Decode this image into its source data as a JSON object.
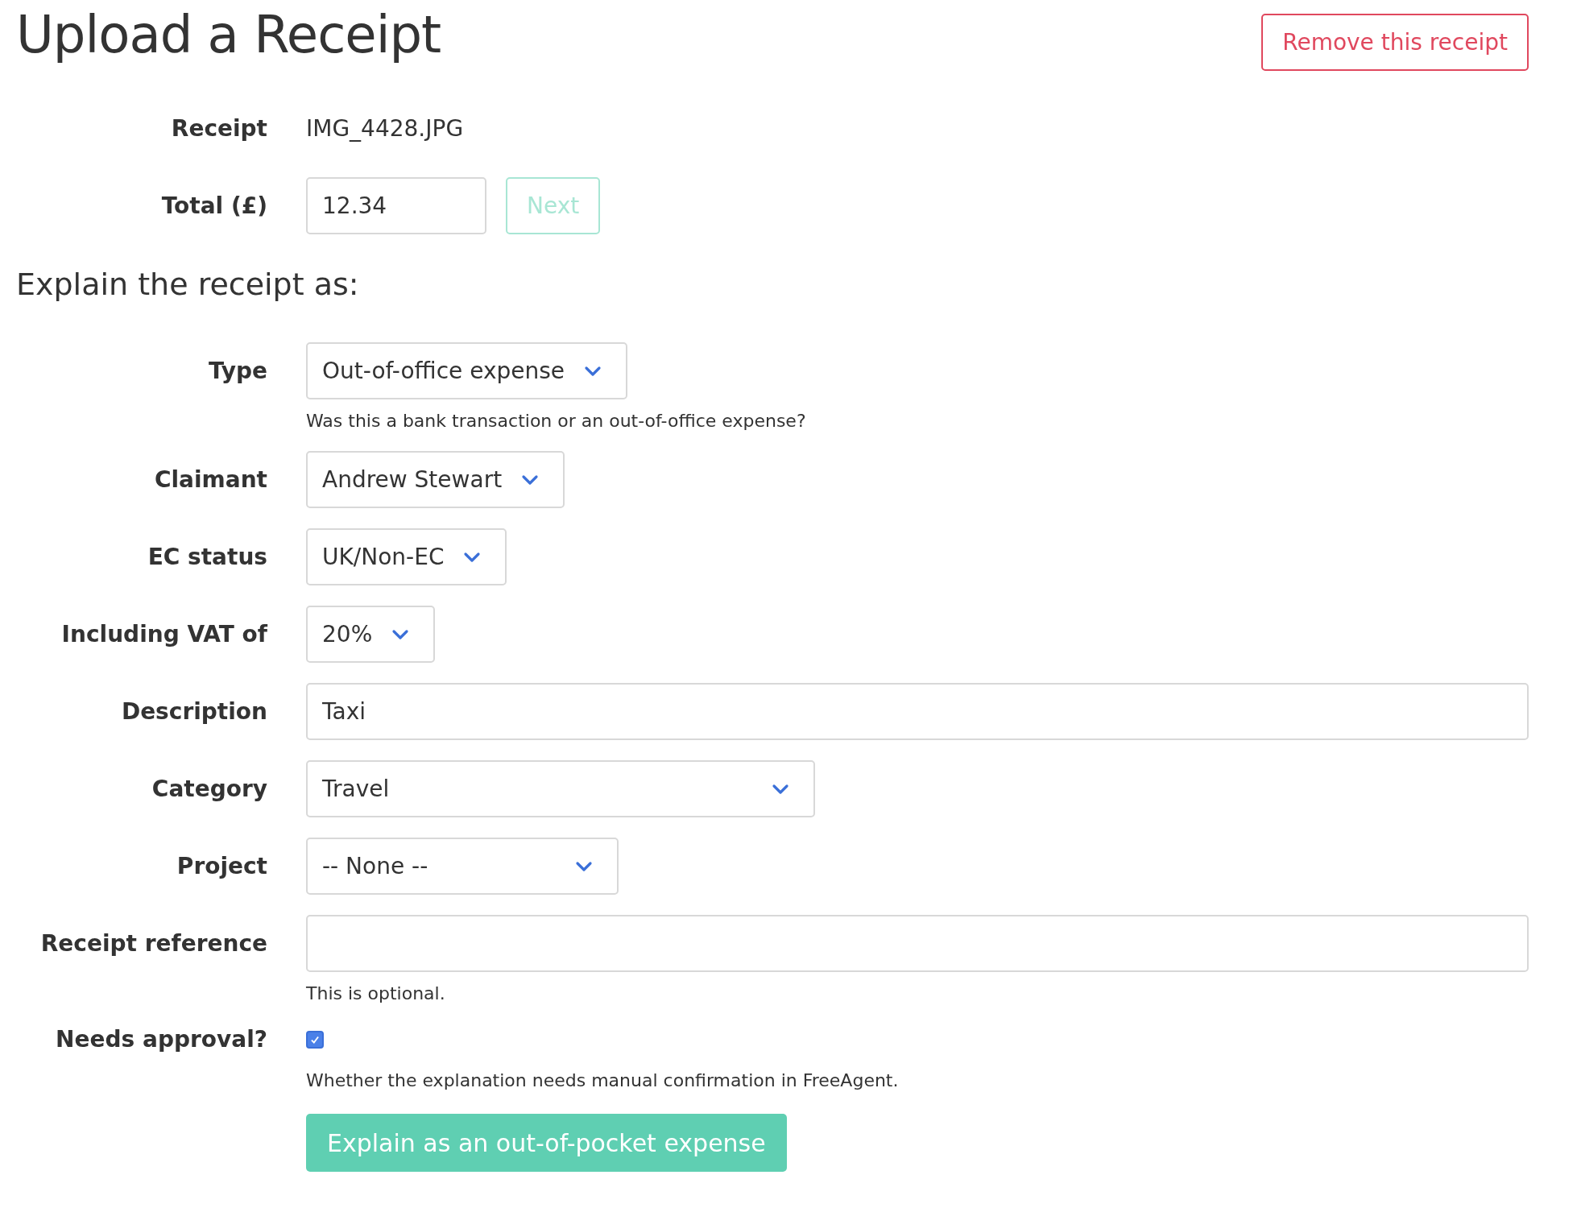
{
  "title": "Upload a Receipt",
  "remove_button": "Remove this receipt",
  "receipt_fields": [
    {
      "kind": "text",
      "label": "Receipt",
      "value": "IMG_4428.JPG"
    },
    {
      "kind": "input",
      "label": "Total (£)",
      "value": "12.34",
      "button": {
        "label": "Next",
        "disabled": true
      }
    }
  ],
  "section_heading": "Explain the receipt as:",
  "fields": [
    {
      "kind": "select",
      "label": "Type",
      "value": "Out-of-office expense",
      "help": "Was this a bank transaction or an out-of-office expense?"
    },
    {
      "kind": "select",
      "label": "Claimant",
      "value": "Andrew Stewart"
    },
    {
      "kind": "select",
      "label": "EC status",
      "value": "UK/Non-EC"
    },
    {
      "kind": "select",
      "label": "Including VAT of",
      "value": "20%"
    },
    {
      "kind": "input",
      "label": "Description",
      "value": "Taxi"
    },
    {
      "kind": "select",
      "label": "Category",
      "value": "Travel"
    },
    {
      "kind": "select",
      "label": "Project",
      "value": "-- None --"
    },
    {
      "kind": "input",
      "label": "Receipt reference",
      "help": "This is optional."
    },
    {
      "kind": "checkbox",
      "label": "Needs approval?",
      "checked": true,
      "help": "Whether the explanation needs manual confirmation in FreeAgent."
    }
  ],
  "submit_button": "Explain as an out-of-pocket expense"
}
